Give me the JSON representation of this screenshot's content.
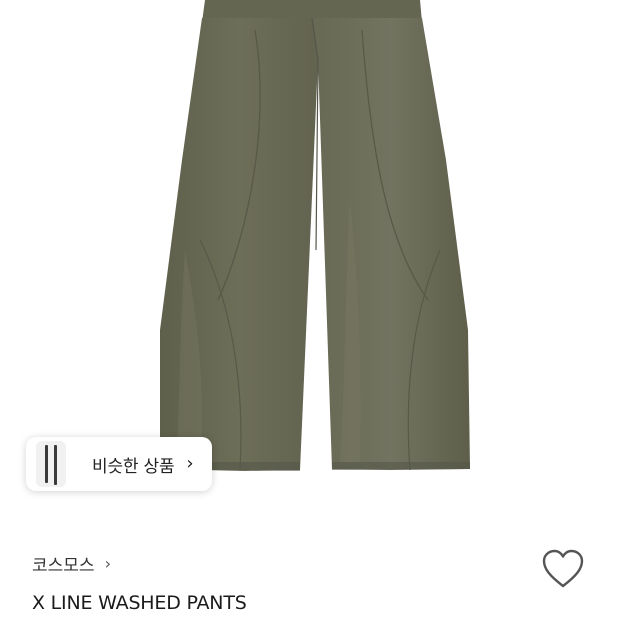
{
  "similar_products": {
    "label": "비슷한 상품",
    "chevron": "›"
  },
  "product": {
    "brand": "코스모스",
    "brand_chevron": "›",
    "name": "X LINE WASHED PANTS",
    "image_icon": "olive-wide-leg-pants-photo",
    "pants_color": "#6b6b55"
  },
  "like": {
    "icon": "heart-outline-icon",
    "liked": false
  }
}
